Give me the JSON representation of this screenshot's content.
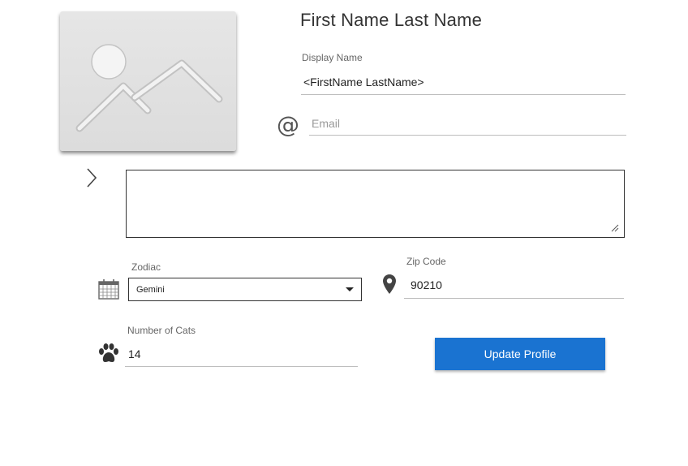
{
  "profile": {
    "full_name": "First Name Last Name",
    "display_name_label": "Display Name",
    "display_name_value": "<FirstName LastName>",
    "email_placeholder": "Email",
    "bio_value": "",
    "zodiac_label": "Zodiac",
    "zodiac_value": "Gemini",
    "zip_label": "Zip Code",
    "zip_value": "90210",
    "cats_label": "Number of Cats",
    "cats_value": "14",
    "update_button_label": "Update Profile"
  },
  "icons": {
    "avatar": "image-placeholder-icon",
    "email": "at-sign-icon",
    "expand": "chevron-right-icon",
    "zodiac": "calendar-icon",
    "zip": "map-pin-icon",
    "cats": "paw-icon"
  },
  "colors": {
    "accent": "#1a73d1",
    "icon": "#444444",
    "underline": "#bdbdbd"
  }
}
